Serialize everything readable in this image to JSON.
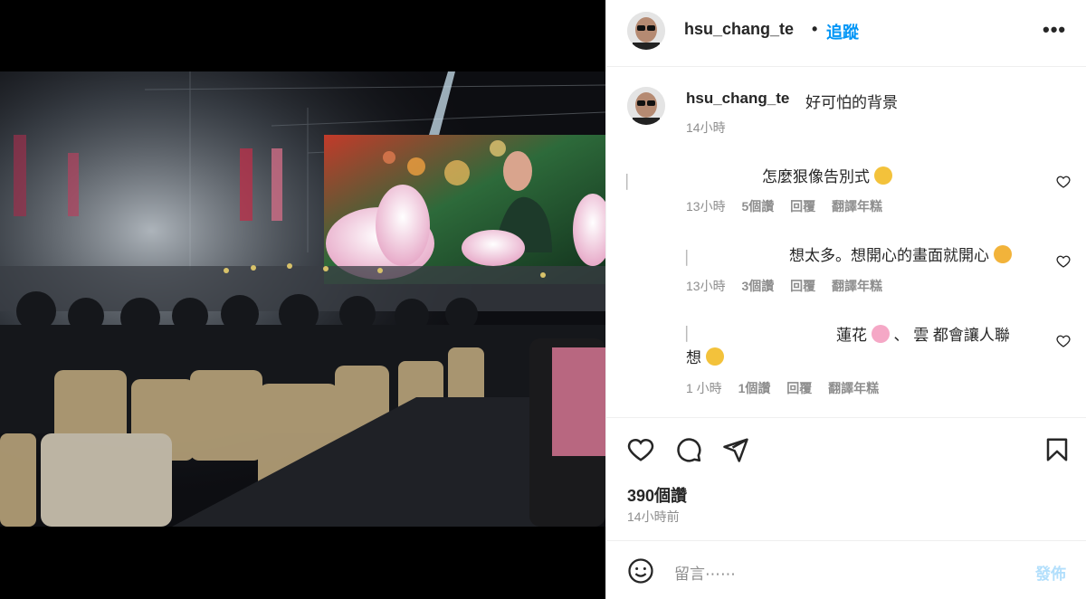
{
  "post": {
    "username": "hsu_chang_te",
    "dot": "•",
    "follow_label": "追蹤",
    "more_icon": "more-horizontal-icon",
    "caption": {
      "username": "hsu_chang_te",
      "text": "好可怕的背景",
      "time": "14小時"
    },
    "comments": [
      {
        "text": "怎麼狠像告別式",
        "emoji": "scream-emoji",
        "time": "13小時",
        "likes": "5個讚",
        "reply": "回覆",
        "translate": "翻譯年糕"
      },
      {
        "text": "想太多。想開心的畫面就開心",
        "emoji": "party-face-emoji",
        "time": "13小時",
        "likes": "3個讚",
        "reply": "回覆",
        "translate": "翻譯年糕"
      },
      {
        "text_a": "蓮花",
        "text_b": "、 雲 都會讓人聯",
        "text_c": "想",
        "emoji_a": "lotus-emoji",
        "emoji_b": "laughing-emoji",
        "time": "1 小時",
        "likes": "1個讚",
        "reply": "回覆",
        "translate": "翻譯年糕"
      }
    ],
    "likes_count": "390個讚",
    "posted_time": "14小時前",
    "composer": {
      "placeholder": "留言⋯⋯",
      "post_label": "發佈"
    }
  },
  "colors": {
    "link": "#0095f6",
    "muted": "#8e8e8e",
    "post_disabled": "#b2dffc"
  }
}
